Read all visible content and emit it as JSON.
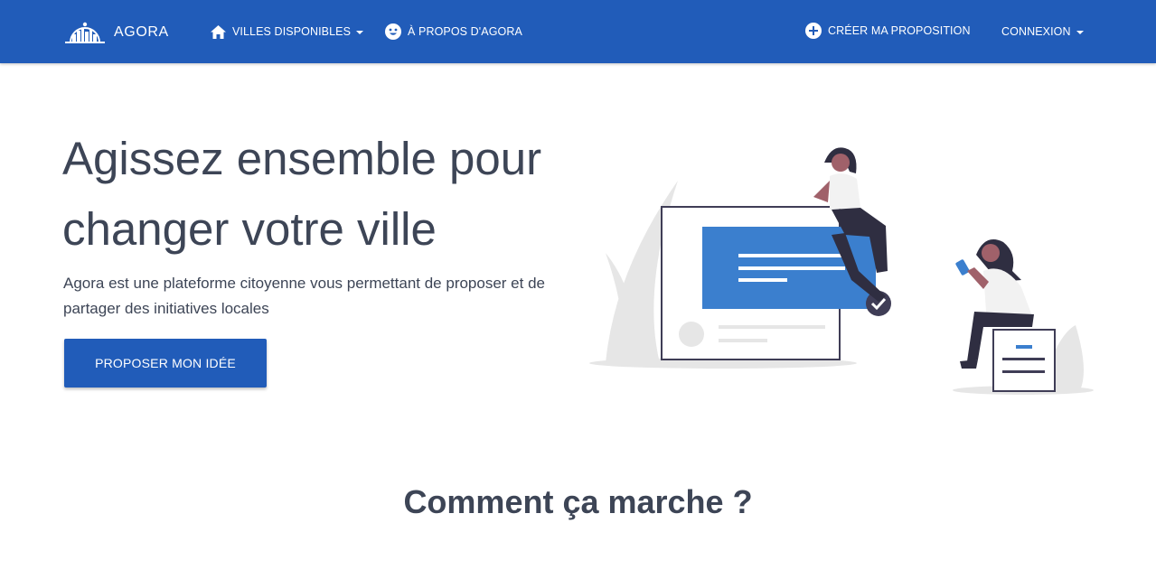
{
  "navbar": {
    "brand": {
      "logo_icon": "city-skyline-logo-icon",
      "label": "AGORA"
    },
    "villes": {
      "icon": "home-icon",
      "label": "VILLES DISPONIBLES"
    },
    "apropos": {
      "icon": "smiley-icon",
      "label": "À PROPOS D'AGORA"
    },
    "creer": {
      "icon": "plus-circle-icon",
      "label": "CRÉER MA PROPOSITION"
    },
    "connexion": {
      "label": "CONNEXION"
    }
  },
  "hero": {
    "title": "Agissez ensemble pour changer votre ville",
    "subtitle": "Agora est une plateforme citoyenne vous permettant de proposer et de partager des initiatives locales",
    "cta_label": "PROPOSER MON IDÉE",
    "illustration": "women-sharing-ideas-illustration"
  },
  "how_it_works": {
    "title": "Comment ça marche ?"
  },
  "colors": {
    "primary": "#215cb9",
    "text": "#3d4556",
    "card_blue": "#3b7fce",
    "dark_figure": "#2f2e41",
    "skin": "#a0616a",
    "grey_shape": "#e6e6e6"
  }
}
